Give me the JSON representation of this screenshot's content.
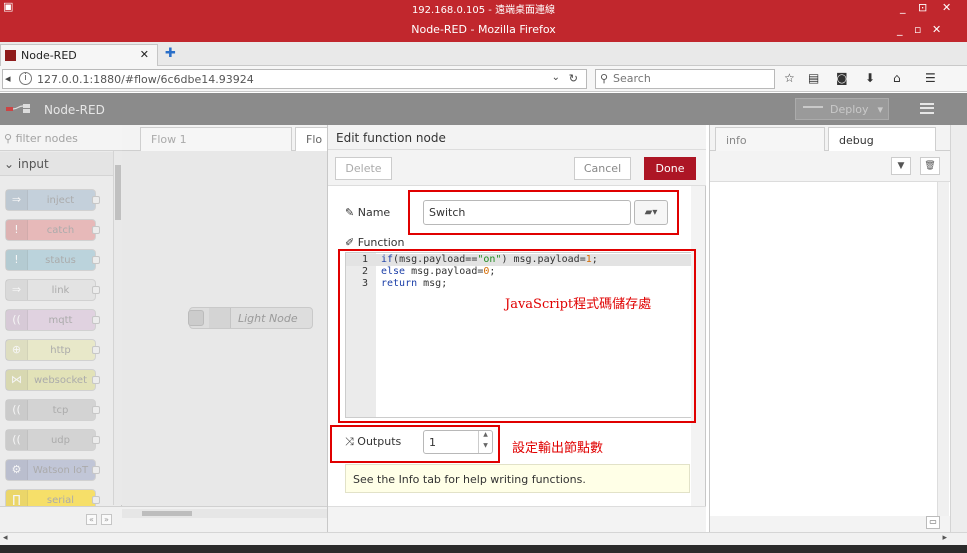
{
  "remote_desktop": {
    "title": "192.168.0.105 - 遠端桌面連線",
    "controls": [
      "_",
      "⊡",
      "✕"
    ]
  },
  "window": {
    "title": "Node-RED - Mozilla Firefox",
    "controls": [
      "_",
      "▫",
      "✕"
    ]
  },
  "browser": {
    "tab_label": "Node-RED",
    "tab_close": "✕",
    "new_tab": "✚",
    "url": "127.0.0.1:1880/#flow/6c6dbe14.93924",
    "search_placeholder": "Search",
    "nav_icons": [
      "star-icon",
      "reading-list-icon",
      "pocket-icon",
      "download-icon",
      "home-icon",
      "menu-icon"
    ]
  },
  "header": {
    "title": "Node-RED",
    "deploy_label": "Deploy"
  },
  "palette": {
    "filter_placeholder": "filter nodes",
    "category": "input",
    "nodes": [
      {
        "label": "inject",
        "color": "#a6bbcf",
        "icon": "⇒"
      },
      {
        "label": "catch",
        "color": "#e49191",
        "icon": "!"
      },
      {
        "label": "status",
        "color": "#94c1d0",
        "icon": "!"
      },
      {
        "label": "link",
        "color": "#dddddd",
        "icon": "⇒"
      },
      {
        "label": "mqtt",
        "color": "#d8bfd8",
        "icon": "(("
      },
      {
        "label": "http",
        "color": "#e7e7ae",
        "icon": "⊕"
      },
      {
        "label": "websocket",
        "color": "#dbdb8f",
        "icon": "⋈"
      },
      {
        "label": "tcp",
        "color": "#c0c0c0",
        "icon": "(("
      },
      {
        "label": "udp",
        "color": "#c0c0c0",
        "icon": "(("
      },
      {
        "label": "Watson IoT",
        "color": "#a0a8c8",
        "icon": "⚙"
      },
      {
        "label": "serial",
        "color": "#ffd700",
        "icon": "∏"
      }
    ]
  },
  "workspace": {
    "tabs": [
      "Flow 1",
      "Flo"
    ],
    "node_label": "Light Node"
  },
  "dialog": {
    "title": "Edit function node",
    "delete_label": "Delete",
    "cancel_label": "Cancel",
    "done_label": "Done",
    "name_label": "Name",
    "name_value": "Switch",
    "function_label": "Function",
    "outputs_label": "Outputs",
    "outputs_value": "1",
    "tip": "See the Info tab for help writing functions."
  },
  "code": [
    "1",
    "2",
    "3"
  ],
  "annotations": {
    "code": "JavaScript程式碼儲存處",
    "outputs": "設定輸出節點數"
  },
  "sidebar": {
    "tabs": [
      "info",
      "debug"
    ]
  },
  "colors": {
    "done_button": "#ad1625",
    "firefox_titlebar": "#c1272d",
    "annotation": "#e00000"
  }
}
